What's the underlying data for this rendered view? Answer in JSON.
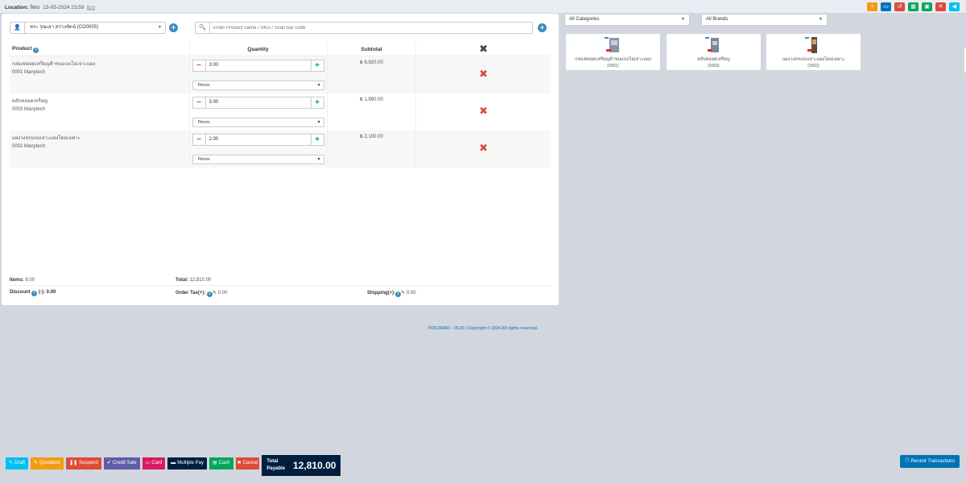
{
  "header": {
    "location_label": "Location:",
    "location_value": "ลิตม",
    "datetime": "13-05-2024 23:59",
    "kbd": "F9",
    "icons": [
      {
        "name": "plus-circle-icon",
        "color": "#f39c12",
        "glyph": "+"
      },
      {
        "name": "calendar-icon",
        "color": "#0073b7",
        "glyph": "▭"
      },
      {
        "name": "undo-icon",
        "color": "#dd4b39",
        "glyph": "↺"
      },
      {
        "name": "calculator-icon",
        "color": "#00a65a",
        "glyph": "▦"
      },
      {
        "name": "briefcase-icon",
        "color": "#00a65a",
        "glyph": "▣"
      },
      {
        "name": "close-window-icon",
        "color": "#dd4b39",
        "glyph": "✕"
      },
      {
        "name": "backward-icon",
        "color": "#00c0ef",
        "glyph": "◀"
      }
    ]
  },
  "customer": {
    "value": "หระ รุณเลา สว่างขัดน์ (CO0005)"
  },
  "search": {
    "placeholder": "Enter Product name / SKU / Scan bar code"
  },
  "table": {
    "headers": {
      "product": "Product",
      "quantity": "Quantity",
      "subtotal": "Subtotal"
    },
    "rows": [
      {
        "name": "กล่องทอยดเหรียญค้าขนแบบไม่เจาะแผง",
        "sku": "0001 Manytech",
        "qty": "3.00",
        "unit": "Pieces",
        "subtotal": "฿ 8,820.00"
      },
      {
        "name": "ตลับทอยดเหรียญ",
        "sku": "0003 Manytech",
        "qty": "3.00",
        "unit": "Pieces",
        "subtotal": "฿ 1,890.00"
      },
      {
        "name": "แผงวงจรแบบเจาะแผงโดยเฉพาะ",
        "sku": "0002 Manytech",
        "qty": "2.00",
        "unit": "Pieces",
        "subtotal": "฿ 2,100.00"
      }
    ]
  },
  "totals": {
    "items_label": "Items:",
    "items_value": "8.00",
    "total_label": "Total:",
    "total_value": "12,810.00",
    "discount_label": "Discount",
    "discount_value": "(-): 0.00",
    "tax_label": "Order Tax(+):",
    "tax_value": "0.00",
    "shipping_label": "Shipping(+):",
    "shipping_value": "0.00"
  },
  "filters": {
    "categories": "All Categories",
    "brands": "All Brands"
  },
  "products": [
    {
      "name": "กล่องทอยดเหรียญค้าขนแบบไม่เจาะแผง",
      "sku": "(0001)"
    },
    {
      "name": "ตลับทอยดเหรียญ",
      "sku": "(0003)"
    },
    {
      "name": "แผงวงจรแบบเจาะแผงโดยเฉพาะ",
      "sku": "(0002)"
    }
  ],
  "footer": {
    "copyright": "POS DEMO - V5.30 | Copyright © 2024 All rights reserved."
  },
  "actions": {
    "draft": "Draft",
    "quotation": "Quotation",
    "suspend": "Suspend",
    "credit_sale": "Credit Sale",
    "card": "Card",
    "multiple_pay": "Multiple Pay",
    "cash": "Cash",
    "cancel": "Cancel",
    "total_label_1": "Total",
    "total_label_2": "Payable",
    "total_payable": "12,810.00",
    "recent": "Recent Transactions"
  },
  "colors": {
    "draft": "#00c0ef",
    "quotation": "#f39c12",
    "suspend": "#dd4b39",
    "credit_sale": "#605ca8",
    "card": "#d81b60",
    "multiple_pay": "#001f3f",
    "cash": "#00a65a",
    "cancel": "#dd4b39"
  }
}
